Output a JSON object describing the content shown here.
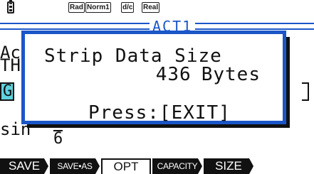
{
  "status_bar": {
    "battery_icon": "battery-icon",
    "tags": [
      "Rad",
      "Norm1",
      "d/c",
      "Real"
    ]
  },
  "program": {
    "title": "ACT1",
    "line1": "Ac",
    "line2": "TH",
    "line3": "G",
    "line4": "sin",
    "fraction_denominator": "6"
  },
  "popup": {
    "title": "Strip Data Size",
    "size_value": "436",
    "size_unit": "Bytes",
    "prompt": "Press:[EXIT]"
  },
  "function_keys": [
    {
      "label": "SAVE",
      "style": "dark"
    },
    {
      "label": "SAVE•AS",
      "style": "dark"
    },
    {
      "label": "OPT",
      "style": "light"
    },
    {
      "label": "CAPACITY",
      "style": "dark"
    },
    {
      "label": "SIZE",
      "style": "dark"
    }
  ],
  "colors": {
    "accent_blue": "#1b56c8",
    "highlight_cyan": "#5fd3e0",
    "text": "#111111"
  }
}
